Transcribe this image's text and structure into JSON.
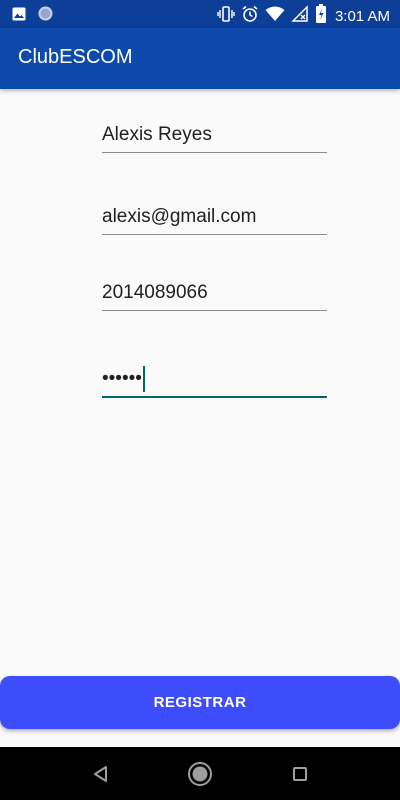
{
  "status_bar": {
    "time": "3:01 AM",
    "icons": [
      "image-notification-icon",
      "circle-notification-icon",
      "vibrate-icon",
      "alarm-icon",
      "wifi-icon",
      "no-signal-icon",
      "battery-icon"
    ]
  },
  "app_bar": {
    "title": "ClubESCOM"
  },
  "form": {
    "name_value": "Alexis Reyes",
    "email_value": "alexis@gmail.com",
    "phone_value": "2014089066",
    "password_value": "••••••"
  },
  "register_button": {
    "label": "REGISTRAR"
  },
  "colors": {
    "status_bar": "#0d3e98",
    "app_bar": "#0e4aac",
    "accent": "#00686b",
    "button": "#3d4dfc"
  },
  "nav_bar": {
    "icons": [
      "back-icon",
      "home-icon",
      "recents-icon"
    ]
  }
}
